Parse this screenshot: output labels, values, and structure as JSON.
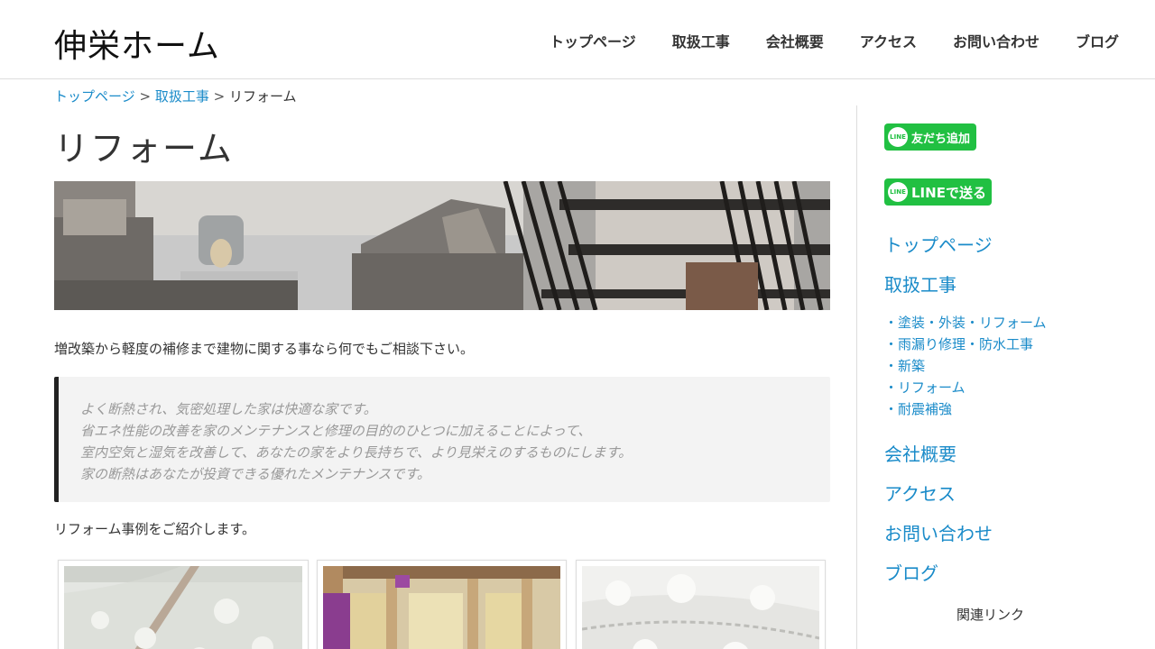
{
  "header": {
    "logo": "伸栄ホーム",
    "nav": [
      "トップページ",
      "取扱工事",
      "会社概要",
      "アクセス",
      "お問い合わせ",
      "ブログ"
    ]
  },
  "breadcrumb": {
    "items": [
      "トップページ",
      "取扱工事"
    ],
    "current": "リフォーム",
    "separator": ">"
  },
  "main": {
    "title": "リフォーム",
    "intro": "増改築から軽度の補修まで建物に関する事なら何でもご相談下さい。",
    "quote_lines": [
      "よく断熱され、気密処理した家は快適な家です。",
      "省エネ性能の改善を家のメンテナンスと修理の目的のひとつに加えることによって、",
      "室内空気と湿気を改善して、あなたの家をより長持ちで、より見栄えのするものにします。",
      "家の断熱はあなたが投資できる優れたメンテナンスです。"
    ],
    "cases_text": "リフォーム事例をご紹介します。"
  },
  "sidebar": {
    "line_add": {
      "badge": "LINE",
      "label": "友だち追加"
    },
    "line_send": {
      "badge": "LINE",
      "label": "LINEで送る"
    },
    "links": [
      "トップページ",
      "取扱工事"
    ],
    "sub_links": [
      "・塗装・外装・リフォーム",
      "・雨漏り修理・防水工事",
      "・新築",
      "・リフォーム",
      "・耐震補強"
    ],
    "links2": [
      "会社概要",
      "アクセス",
      "お問い合わせ",
      "ブログ"
    ],
    "related": "関連リンク"
  },
  "colors": {
    "link": "#1a8bc9",
    "line_green": "#21c042",
    "quote_bg": "#f3f3f3",
    "quote_border": "#222222"
  }
}
